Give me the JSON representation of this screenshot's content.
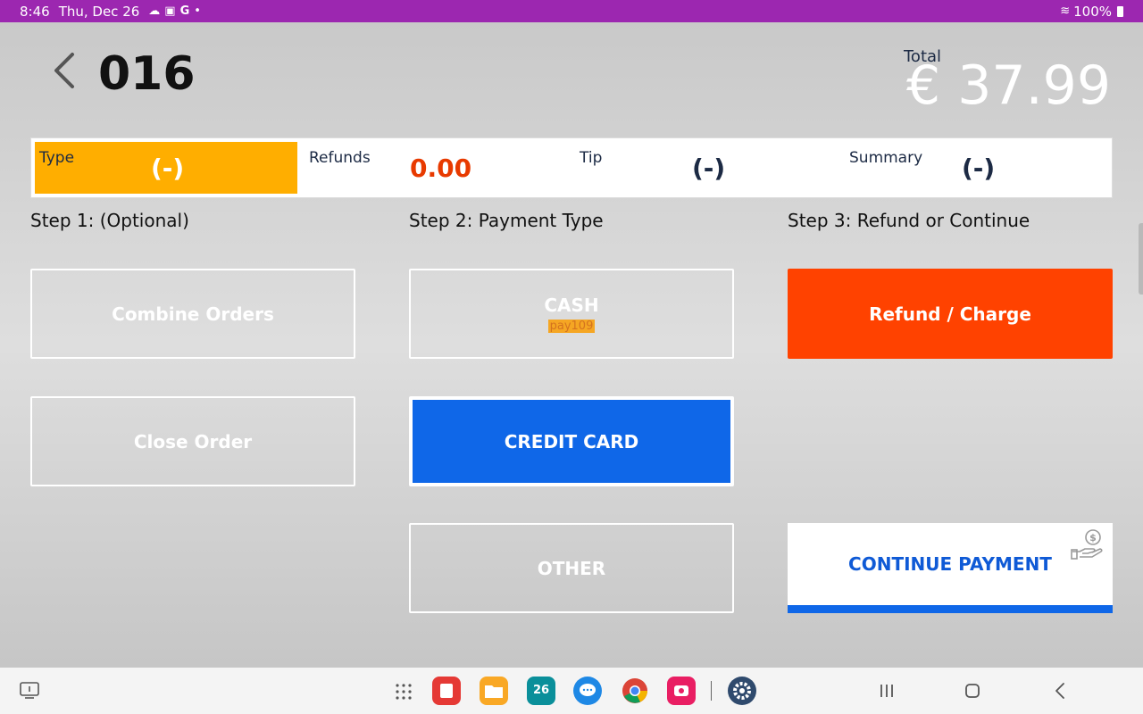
{
  "status": {
    "time": "8:46",
    "date": "Thu, Dec 26",
    "battery": "100%"
  },
  "order": {
    "number": "016",
    "total_label": "Total",
    "total_value": "€ 37.99"
  },
  "summary": {
    "type_label": "Type",
    "type_value": "(-)",
    "refunds_label": "Refunds",
    "refunds_value": "0.00",
    "tip_label": "Tip",
    "tip_value": "(-)",
    "summary_label": "Summary",
    "summary_value": "(-)"
  },
  "steps": {
    "step1": "Step 1: (Optional)",
    "step2": "Step 2: Payment Type",
    "step3": "Step 3: Refund or Continue"
  },
  "buttons": {
    "combine_orders": "Combine Orders",
    "close_order": "Close Order",
    "cash": "CASH",
    "cash_tag": "pay109",
    "credit_card": "CREDIT CARD",
    "other": "OTHER",
    "refund_charge": "Refund / Charge",
    "continue_payment": "CONTINUE PAYMENT"
  },
  "colors": {
    "status_bar": "#9c27b0",
    "type_highlight": "#ffae00",
    "refund_button": "#ff4200",
    "credit_card_button": "#0f67e8",
    "refunds_value": "#e83a00"
  },
  "nav": {
    "date_badge": "26"
  }
}
